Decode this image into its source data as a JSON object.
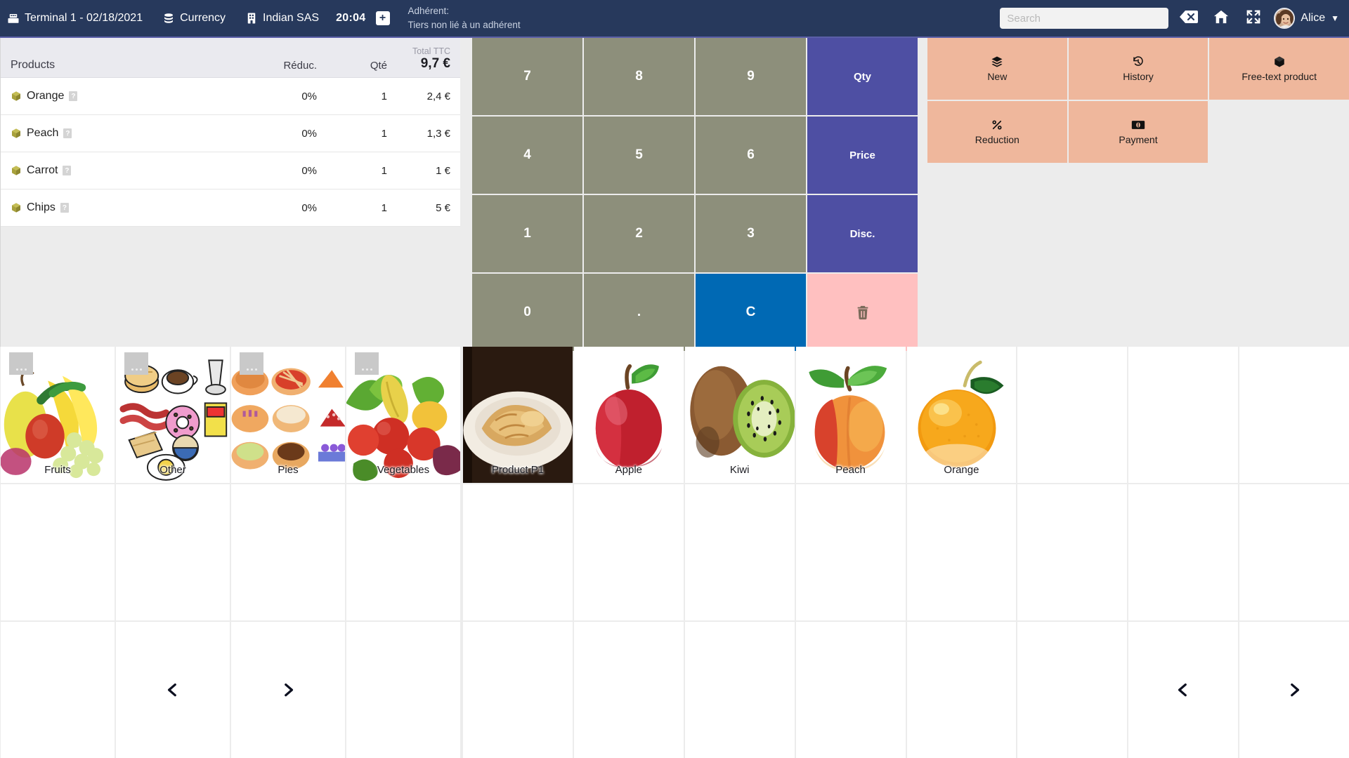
{
  "topbar": {
    "terminal": "Terminal 1 - 02/18/2021",
    "terminal_icon": "cash-register-icon",
    "currency": "Currency",
    "currency_icon": "coins-icon",
    "company": "Indian SAS",
    "company_icon": "building-icon",
    "time": "20:04",
    "add_label": "+",
    "adherent_label": "Adhérent:",
    "adherent_value": "Tiers non lié à un adhérent",
    "search_placeholder": "Search",
    "search_value": "",
    "clear_icon": "backspace-icon",
    "home_icon": "home-icon",
    "fullscreen_icon": "expand-icon",
    "avatar_icon": "user-avatar",
    "user_name": "Alice",
    "caret_icon": "chevron-down-icon"
  },
  "cart": {
    "columns": {
      "products": "Products",
      "reduc": "Réduc.",
      "qte": "Qté",
      "total_label": "Total TTC",
      "total_value": "9,7 €"
    },
    "rows": [
      {
        "name": "Orange",
        "icon": "box-icon",
        "badge": "?",
        "reduc": "0%",
        "qty": "1",
        "total": "2,4 €"
      },
      {
        "name": "Peach",
        "icon": "box-icon",
        "badge": "?",
        "reduc": "0%",
        "qty": "1",
        "total": "1,3 €"
      },
      {
        "name": "Carrot",
        "icon": "box-icon",
        "badge": "?",
        "reduc": "0%",
        "qty": "1",
        "total": "1 €"
      },
      {
        "name": "Chips",
        "icon": "box-icon",
        "badge": "?",
        "reduc": "0%",
        "qty": "1",
        "total": "5 €"
      }
    ]
  },
  "keypad": {
    "keys": [
      {
        "label": "7",
        "kind": "num"
      },
      {
        "label": "8",
        "kind": "num"
      },
      {
        "label": "9",
        "kind": "num"
      },
      {
        "label": "Qty",
        "kind": "act"
      },
      {
        "label": "4",
        "kind": "num"
      },
      {
        "label": "5",
        "kind": "num"
      },
      {
        "label": "6",
        "kind": "num"
      },
      {
        "label": "Price",
        "kind": "act"
      },
      {
        "label": "1",
        "kind": "num"
      },
      {
        "label": "2",
        "kind": "num"
      },
      {
        "label": "3",
        "kind": "num"
      },
      {
        "label": "Disc.",
        "kind": "act"
      },
      {
        "label": "0",
        "kind": "num"
      },
      {
        "label": ".",
        "kind": "num"
      },
      {
        "label": "C",
        "kind": "clear"
      },
      {
        "label": "",
        "kind": "delete",
        "icon": "trash-icon"
      }
    ]
  },
  "actions": [
    {
      "label": "New",
      "icon": "layers-icon"
    },
    {
      "label": "History",
      "icon": "history-icon"
    },
    {
      "label": "Free-text product",
      "icon": "box-icon"
    },
    {
      "label": "Reduction",
      "icon": "percent-icon"
    },
    {
      "label": "Payment",
      "icon": "banknote-icon"
    }
  ],
  "categories": [
    {
      "label": "Fruits",
      "art": "fruits",
      "placeholder": true
    },
    {
      "label": "Other",
      "art": "other",
      "placeholder": true
    },
    {
      "label": "Pies",
      "art": "pies",
      "placeholder": true
    },
    {
      "label": "Vegetables",
      "art": "vegetables",
      "placeholder": true
    }
  ],
  "category_nav": {
    "prev_icon": "chevron-left-icon",
    "next_icon": "chevron-right-icon"
  },
  "products": [
    {
      "label": "Product P1",
      "art": "pie"
    },
    {
      "label": "Apple",
      "art": "apple"
    },
    {
      "label": "Kiwi",
      "art": "kiwi"
    },
    {
      "label": "Peach",
      "art": "peach"
    },
    {
      "label": "Orange",
      "art": "orange"
    }
  ],
  "product_nav": {
    "prev_icon": "chevron-left-icon",
    "next_icon": "chevron-right-icon"
  },
  "colors": {
    "header_bg": "#27395c",
    "header_accent": "#5b5fa8",
    "key_num": "#8d8f7b",
    "key_action": "#4e4fa3",
    "key_clear": "#0069b4",
    "key_delete": "#ffc0c0",
    "action_button": "#efb79c",
    "page_bg": "#ececec"
  }
}
